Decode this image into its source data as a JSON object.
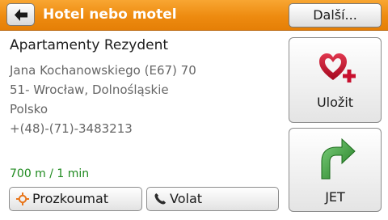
{
  "header": {
    "title": "Hotel nebo motel",
    "more_label": "Další..."
  },
  "poi": {
    "name": "Apartamenty Rezydent",
    "address_lines": [
      "Jana Kochanowskiego (E67) 70",
      "51- Wrocław, Dolnośląskie",
      "Polsko",
      "+(48)-(71)-3483213"
    ],
    "distance": "700 m / 1 min"
  },
  "actions": {
    "explore_label": "Prozkoumat",
    "call_label": "Volat",
    "save_label": "Uložit",
    "go_label": "JET"
  },
  "colors": {
    "header_orange": "#ee8b10",
    "distance_green": "#1f8a1f",
    "heart_red": "#c8102e",
    "arrow_green": "#2e8b2e"
  },
  "icons": {
    "back": "back-arrow-icon",
    "explore": "crosshair-icon",
    "call": "phone-icon",
    "save": "heart-plus-icon",
    "go": "curved-arrow-icon"
  }
}
